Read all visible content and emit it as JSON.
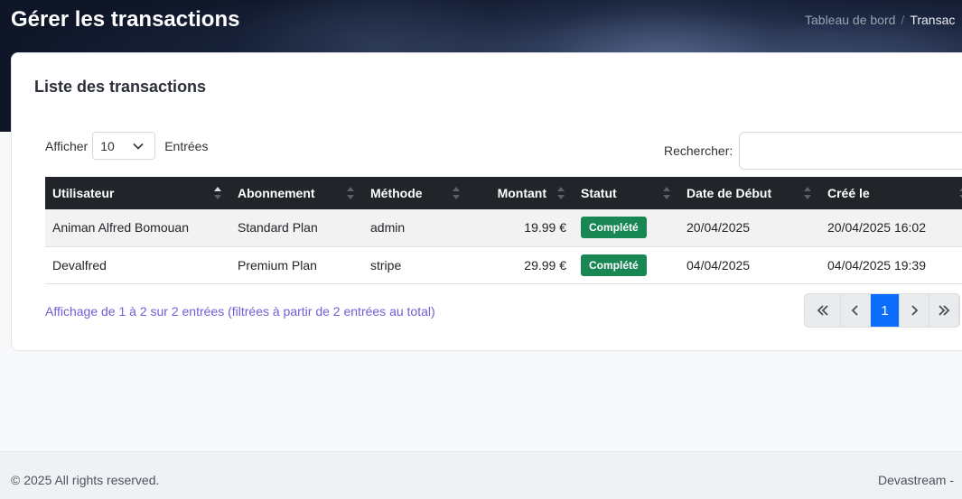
{
  "header": {
    "title": "Gérer les transactions",
    "breadcrumb": [
      "Tableau de bord",
      "Transac"
    ],
    "breadcrumb_separator": "/"
  },
  "card": {
    "title": "Liste des transactions",
    "length": {
      "before": "Afficher",
      "value": "10",
      "after": "Entrées"
    },
    "search_label": "Rechercher:",
    "search_value": "",
    "columns": [
      "Utilisateur",
      "Abonnement",
      "Méthode",
      "Montant",
      "Statut",
      "Date de Début",
      "Créé le"
    ],
    "rows": [
      {
        "user": "Animan Alfred Bomouan",
        "plan": "Standard Plan",
        "method": "admin",
        "amount": "19.99 €",
        "status": "Complété",
        "start": "20/04/2025",
        "created": "20/04/2025 16:02"
      },
      {
        "user": "Devalfred",
        "plan": "Premium Plan",
        "method": "stripe",
        "amount": "29.99 €",
        "status": "Complété",
        "start": "04/04/2025",
        "created": "04/04/2025 19:39"
      }
    ],
    "info": "Affichage de 1 à 2 sur 2 entrées (filtrées à partir de 2 entrées au total)",
    "pagination": {
      "current": "1"
    }
  },
  "footer": {
    "copyright": "© 2025 All rights reserved.",
    "brand": "Devastream -"
  },
  "colors": {
    "status_badge": "#198754",
    "active_page": "#0d6efd",
    "table_header": "#212529",
    "info_text": "#6f5fd6"
  },
  "icons": [
    "chevron-down-icon",
    "sort-icon",
    "chevrons-left-icon",
    "chevron-left-icon",
    "chevron-right-icon",
    "chevrons-right-icon"
  ]
}
